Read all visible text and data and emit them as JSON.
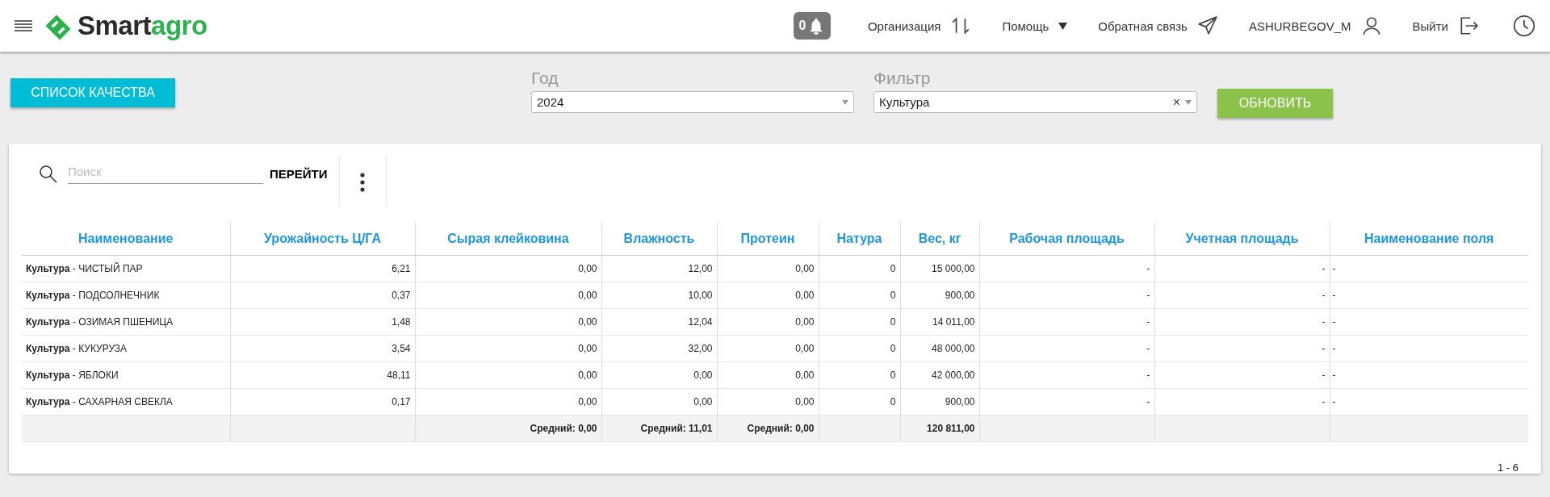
{
  "header": {
    "brand_dark": "Smart",
    "brand_accent": "agro",
    "notifications": "0",
    "nav": [
      {
        "kind": "swap",
        "label": "Организация"
      },
      {
        "kind": "dropdown",
        "label": "Помощь"
      },
      {
        "kind": "send",
        "label": "Обратная связь"
      },
      {
        "kind": "user",
        "label": "ASHURBEGOV_M"
      },
      {
        "kind": "exit",
        "label": "Выйти"
      }
    ]
  },
  "toolbar": {
    "list_button": "СПИСОК КАЧЕСТВА",
    "year": {
      "label": "Год",
      "value": "2024"
    },
    "filter": {
      "label": "Фильтр",
      "value": "Культура",
      "clear": "×"
    },
    "refresh_button": "ОБНОВИТЬ"
  },
  "search": {
    "placeholder": "Поиск",
    "go_button": "ПЕРЕЙТИ"
  },
  "table": {
    "columns": [
      {
        "title": "Наименование"
      },
      {
        "title": "Урожайность Ц/ГА"
      },
      {
        "title": "Сырая клейковина",
        "total": "Средний: 0,00"
      },
      {
        "title": "Влажность",
        "total": "Средний: 11,01"
      },
      {
        "title": "Протеин",
        "total": "Средний: 0,00"
      },
      {
        "title": "Натура"
      },
      {
        "title": "Вес, кг",
        "total": "120 811,00"
      },
      {
        "title": "Рабочая площадь"
      },
      {
        "title": "Учетная площадь"
      },
      {
        "title": "Наименование поля"
      }
    ],
    "rows": [
      [
        "**Культура** - ЧИСТЫЙ ПАР",
        "6,21",
        "0,00",
        "12,00",
        "0,00",
        "0",
        "15 000,00",
        "-",
        "-",
        "-"
      ],
      [
        "**Культура** - ПОДСОЛНЕЧНИК",
        "0,37",
        "0,00",
        "10,00",
        "0,00",
        "0",
        "900,00",
        "-",
        "-",
        "-"
      ],
      [
        "**Культура** - ОЗИМАЯ ПШЕНИЦА",
        "1,48",
        "0,00",
        "12,04",
        "0,00",
        "0",
        "14 011,00",
        "-",
        "-",
        "-"
      ],
      [
        "**Культура** - КУКУРУЗА",
        "3,54",
        "0,00",
        "32,00",
        "0,00",
        "0",
        "48 000,00",
        "-",
        "-",
        "-"
      ],
      [
        "**Культура** - ЯБЛОКИ",
        "48,11",
        "0,00",
        "0,00",
        "0,00",
        "0",
        "42 000,00",
        "-",
        "-",
        "-"
      ],
      [
        "**Культура** - САХАРНАЯ СВЕКЛА",
        "0,17",
        "0,00",
        "0,00",
        "0,00",
        "0",
        "900,00",
        "-",
        "-",
        "-"
      ]
    ]
  },
  "pagination": "1 - 6"
}
